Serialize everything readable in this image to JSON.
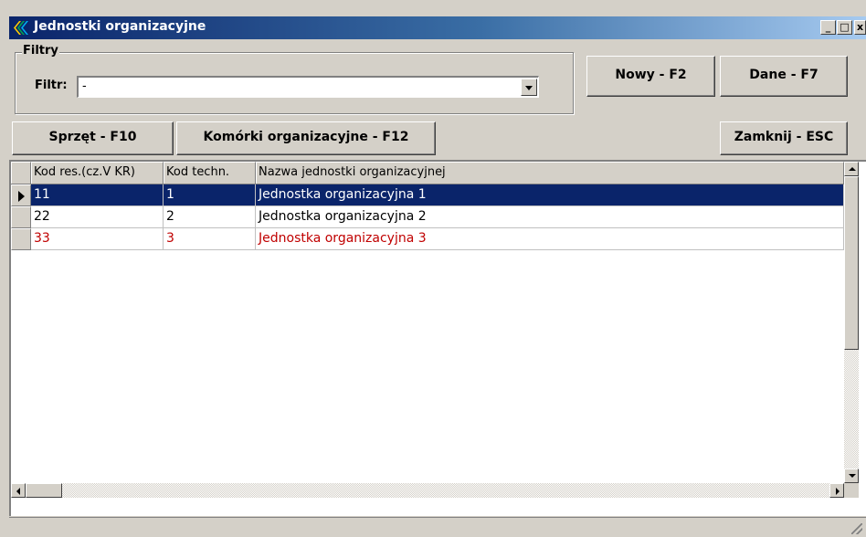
{
  "window": {
    "title": "Jednostki organizacyjne",
    "controls": {
      "minimize": "_",
      "maximize": "□",
      "close": "x"
    }
  },
  "filters": {
    "group_title": "Filtry",
    "filter_label": "Filtr:",
    "filter_value": "-"
  },
  "buttons": {
    "new": "Nowy - F2",
    "data": "Dane - F7",
    "equipment": "Sprzęt - F10",
    "org_cells": "Komórki organizacyjne - F12",
    "close": "Zamknij - ESC"
  },
  "grid": {
    "columns": [
      "Kod res.(cz.V KR)",
      "Kod techn.",
      "Nazwa jednostki organizacyjnej"
    ],
    "rows": [
      {
        "kod_res": "11",
        "kod_techn": "1",
        "nazwa": "Jednostka organizacyjna 1",
        "state": "selected"
      },
      {
        "kod_res": "22",
        "kod_techn": "2",
        "nazwa": "Jednostka organizacyjna 2",
        "state": "normal"
      },
      {
        "kod_res": "33",
        "kod_techn": "3",
        "nazwa": "Jednostka organizacyjna 3",
        "state": "inactive"
      }
    ]
  },
  "colors": {
    "selection": "#0a246a",
    "inactive_text": "#c00000",
    "face": "#d4d0c8"
  }
}
